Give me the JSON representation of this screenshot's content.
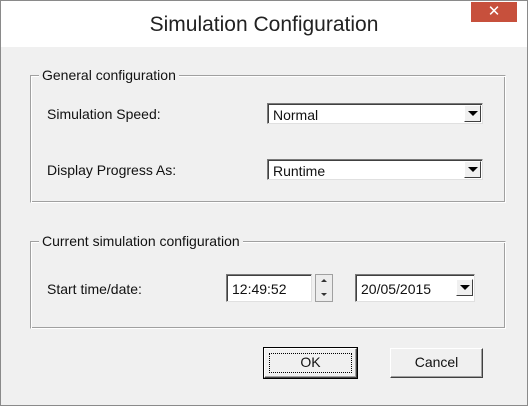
{
  "window": {
    "title": "Simulation Configuration",
    "close_glyph": "✕"
  },
  "general": {
    "legend": "General configuration",
    "speed_label": "Simulation Speed:",
    "speed_value": "Normal",
    "progress_label": "Display Progress As:",
    "progress_value": "Runtime"
  },
  "current": {
    "legend": "Current simulation configuration",
    "start_label": "Start time/date:",
    "time_value": "12:49:52",
    "date_value": "20/05/2015"
  },
  "buttons": {
    "ok_label": "OK",
    "cancel_label": "Cancel"
  },
  "icons": {
    "close": "close-icon",
    "dropdown": "chevron-down-icon",
    "spin_up": "spin-up-icon",
    "spin_down": "spin-down-icon"
  },
  "colors": {
    "close_button": "#c7503c",
    "dialog_face": "#f0f0f0",
    "title_bar": "#ffffff"
  }
}
